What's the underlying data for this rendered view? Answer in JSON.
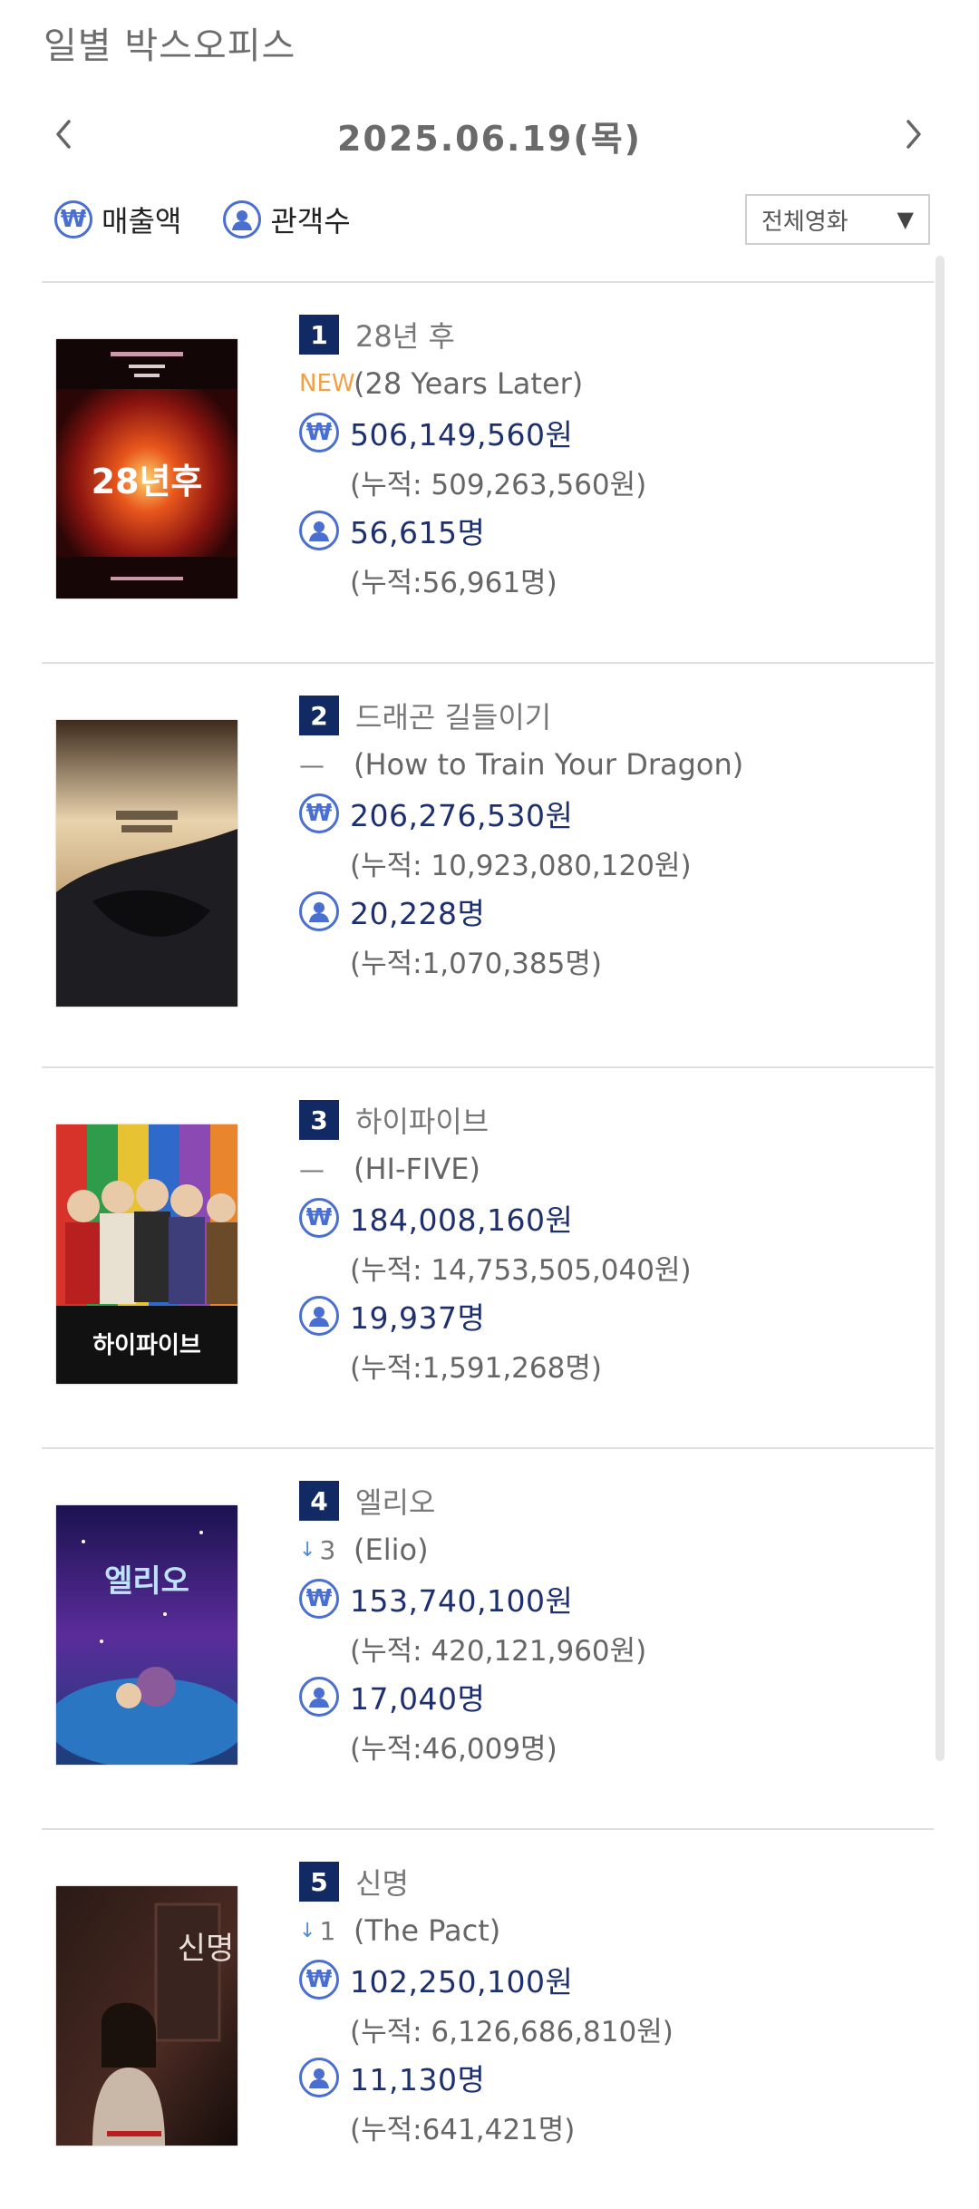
{
  "page_title": "일별 박스오피스",
  "date_label": "2025.06.19(목)",
  "legend": {
    "revenue_label": "매출액",
    "audience_label": "관객수"
  },
  "filter": {
    "selected": "전체영화"
  },
  "icons": {
    "prev": "chevron-left-icon",
    "next": "chevron-right-icon",
    "revenue": "won-circle-icon",
    "audience": "person-circle-icon",
    "dropdown": "triangle-down-icon"
  },
  "colors": {
    "rank_badge": "#112a63",
    "icon_blue": "#4a6fd0",
    "value_text": "#1d2f6e",
    "new_label": "#f0a046",
    "down_arrow": "#4a8de0"
  },
  "won_symbol": "₩",
  "movies": [
    {
      "rank": "1",
      "title_ko": "28년 후",
      "change": "NEW",
      "change_type": "new",
      "title_en": "(28 Years Later)",
      "revenue": "506,149,560원",
      "revenue_cumulative": "(누적: 509,263,560원)",
      "audience": "56,615명",
      "audience_cumulative": "(누적:56,961명)"
    },
    {
      "rank": "2",
      "title_ko": "드래곤 길들이기",
      "change": "—",
      "change_type": "same",
      "title_en": "(How to Train Your Dragon)",
      "revenue": "206,276,530원",
      "revenue_cumulative": "(누적: 10,923,080,120원)",
      "audience": "20,228명",
      "audience_cumulative": "(누적:1,070,385명)"
    },
    {
      "rank": "3",
      "title_ko": "하이파이브",
      "change": "—",
      "change_type": "same",
      "title_en": "(HI-FIVE)",
      "revenue": "184,008,160원",
      "revenue_cumulative": "(누적: 14,753,505,040원)",
      "audience": "19,937명",
      "audience_cumulative": "(누적:1,591,268명)"
    },
    {
      "rank": "4",
      "title_ko": "엘리오",
      "change": "3",
      "change_type": "down",
      "title_en": "(Elio)",
      "revenue": "153,740,100원",
      "revenue_cumulative": "(누적: 420,121,960원)",
      "audience": "17,040명",
      "audience_cumulative": "(누적:46,009명)"
    },
    {
      "rank": "5",
      "title_ko": "신명",
      "change": "1",
      "change_type": "down",
      "title_en": "(The Pact)",
      "revenue": "102,250,100원",
      "revenue_cumulative": "(누적: 6,126,686,810원)",
      "audience": "11,130명",
      "audience_cumulative": "(누적:641,421명)"
    }
  ],
  "poster_text": {
    "p1": "28년후",
    "p3": "하이파이브",
    "p4": "엘리오",
    "p5": "신명"
  }
}
